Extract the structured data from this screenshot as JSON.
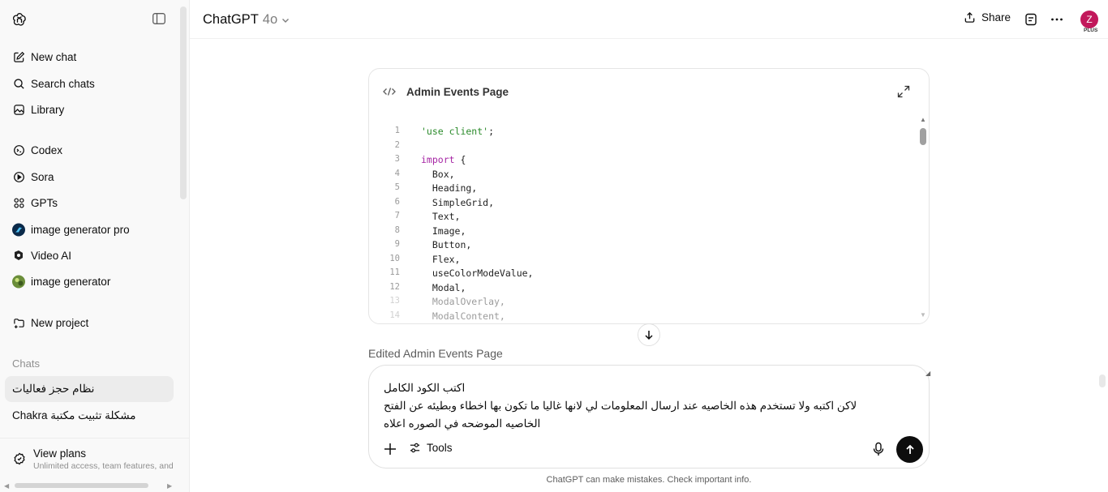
{
  "sidebar": {
    "nav": [
      {
        "label": "New chat",
        "icon": "pencil-square-icon"
      },
      {
        "label": "Search chats",
        "icon": "search-icon"
      },
      {
        "label": "Library",
        "icon": "library-icon"
      }
    ],
    "apps": [
      {
        "label": "Codex",
        "icon": "codex-icon"
      },
      {
        "label": "Sora",
        "icon": "sora-play-icon"
      },
      {
        "label": "GPTs",
        "icon": "grid-icon"
      },
      {
        "label": "image generator pro",
        "icon": "gpt-avatar-icon"
      },
      {
        "label": "Video AI",
        "icon": "video-ai-icon"
      },
      {
        "label": "image generator",
        "icon": "gpt-avatar-icon"
      }
    ],
    "new_project": "New project",
    "chats_heading": "Chats",
    "chats": [
      {
        "label": "نظام حجز فعاليات",
        "active": true
      },
      {
        "label": "مشكلة تثبيت مكتبة Chakra",
        "active": false
      }
    ],
    "view_plans": {
      "title": "View plans",
      "subtitle": "Unlimited access, team features, and m"
    }
  },
  "header": {
    "model_name": "ChatGPT",
    "model_version": "4o",
    "share_label": "Share",
    "avatar_letter": "Z",
    "plan_badge": "PLUS"
  },
  "canvas": {
    "title": "Admin Events Page",
    "lines": [
      {
        "n": "1",
        "text": "'use client';"
      },
      {
        "n": "2",
        "text": ""
      },
      {
        "n": "3",
        "text": "import {"
      },
      {
        "n": "4",
        "text": "  Box,"
      },
      {
        "n": "5",
        "text": "  Heading,"
      },
      {
        "n": "6",
        "text": "  SimpleGrid,"
      },
      {
        "n": "7",
        "text": "  Text,"
      },
      {
        "n": "8",
        "text": "  Image,"
      },
      {
        "n": "9",
        "text": "  Button,"
      },
      {
        "n": "10",
        "text": "  Flex,"
      },
      {
        "n": "11",
        "text": "  useColorModeValue,"
      },
      {
        "n": "12",
        "text": "  Modal,"
      },
      {
        "n": "13",
        "text": "  ModalOverlay,"
      },
      {
        "n": "14",
        "text": "  ModalContent,"
      }
    ]
  },
  "edited_label": "Edited Admin Events Page",
  "composer": {
    "line1": "اكتب الكود الكامل",
    "line2": "لاكن اكتبه ولا تستخدم هذه الخاصيه عند ارسال المعلومات لي  لانها غاليا ما تكون بها اخطاء وبطيئه عن الفتح",
    "line3": "الخاصيه الموضحه في الصوره اعلاه",
    "tools_label": "Tools"
  },
  "disclaimer": "ChatGPT can make mistakes. Check important info.",
  "colors": {
    "avatar": "#c2185b",
    "string": "#2a8a2a",
    "keyword": "#a626a4",
    "send_button": "#0d0d0d"
  }
}
